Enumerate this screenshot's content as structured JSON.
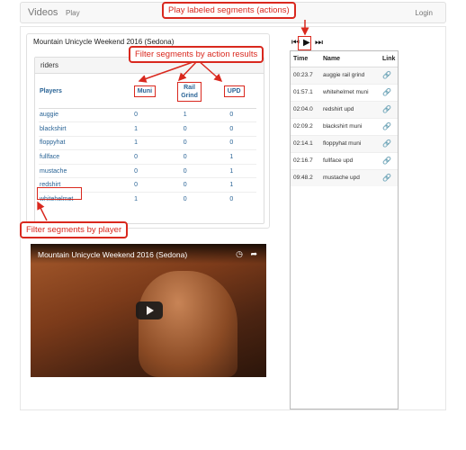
{
  "nav": {
    "brand": "Videos",
    "play": "Play",
    "login": "Login"
  },
  "panel": {
    "title": "Mountain Unicycle Weekend 2016 (Sedona)",
    "subheading": "riders"
  },
  "riders_table": {
    "headers": {
      "players": "Players",
      "muni": "Muni",
      "rail_grind_1": "Rail",
      "rail_grind_2": "Grind",
      "upd": "UPD"
    },
    "rows": [
      {
        "player": "auggie",
        "muni": "0",
        "rail_grind": "1",
        "upd": "0"
      },
      {
        "player": "blackshirt",
        "muni": "1",
        "rail_grind": "0",
        "upd": "0"
      },
      {
        "player": "floppyhat",
        "muni": "1",
        "rail_grind": "0",
        "upd": "0"
      },
      {
        "player": "fullface",
        "muni": "0",
        "rail_grind": "0",
        "upd": "1"
      },
      {
        "player": "mustache",
        "muni": "0",
        "rail_grind": "0",
        "upd": "1"
      },
      {
        "player": "redshirt",
        "muni": "0",
        "rail_grind": "0",
        "upd": "1"
      },
      {
        "player": "whitehelmet",
        "muni": "1",
        "rail_grind": "0",
        "upd": "0"
      }
    ]
  },
  "playlist": {
    "headers": {
      "time": "Time",
      "name": "Name",
      "link": "Link"
    },
    "rows": [
      {
        "time": "00:23.7",
        "name": "auggie rail grind"
      },
      {
        "time": "01:57.1",
        "name": "whitehelmet muni"
      },
      {
        "time": "02:04.0",
        "name": "redshirt upd"
      },
      {
        "time": "02:09.2",
        "name": "blackshirt muni"
      },
      {
        "time": "02:14.1",
        "name": "floppyhat muni"
      },
      {
        "time": "02:16.7",
        "name": "fullface upd"
      },
      {
        "time": "09:48.2",
        "name": "mustache upd"
      }
    ]
  },
  "video": {
    "title": "Mountain Unicycle Weekend 2016 (Sedona)"
  },
  "annotations": {
    "play_segments": "Play labeled segments (actions)",
    "filter_actions": "Filter segments by action results",
    "filter_player": "Filter segments by player"
  },
  "colors": {
    "annotation": "#d9281e",
    "link": "#2a6496"
  }
}
